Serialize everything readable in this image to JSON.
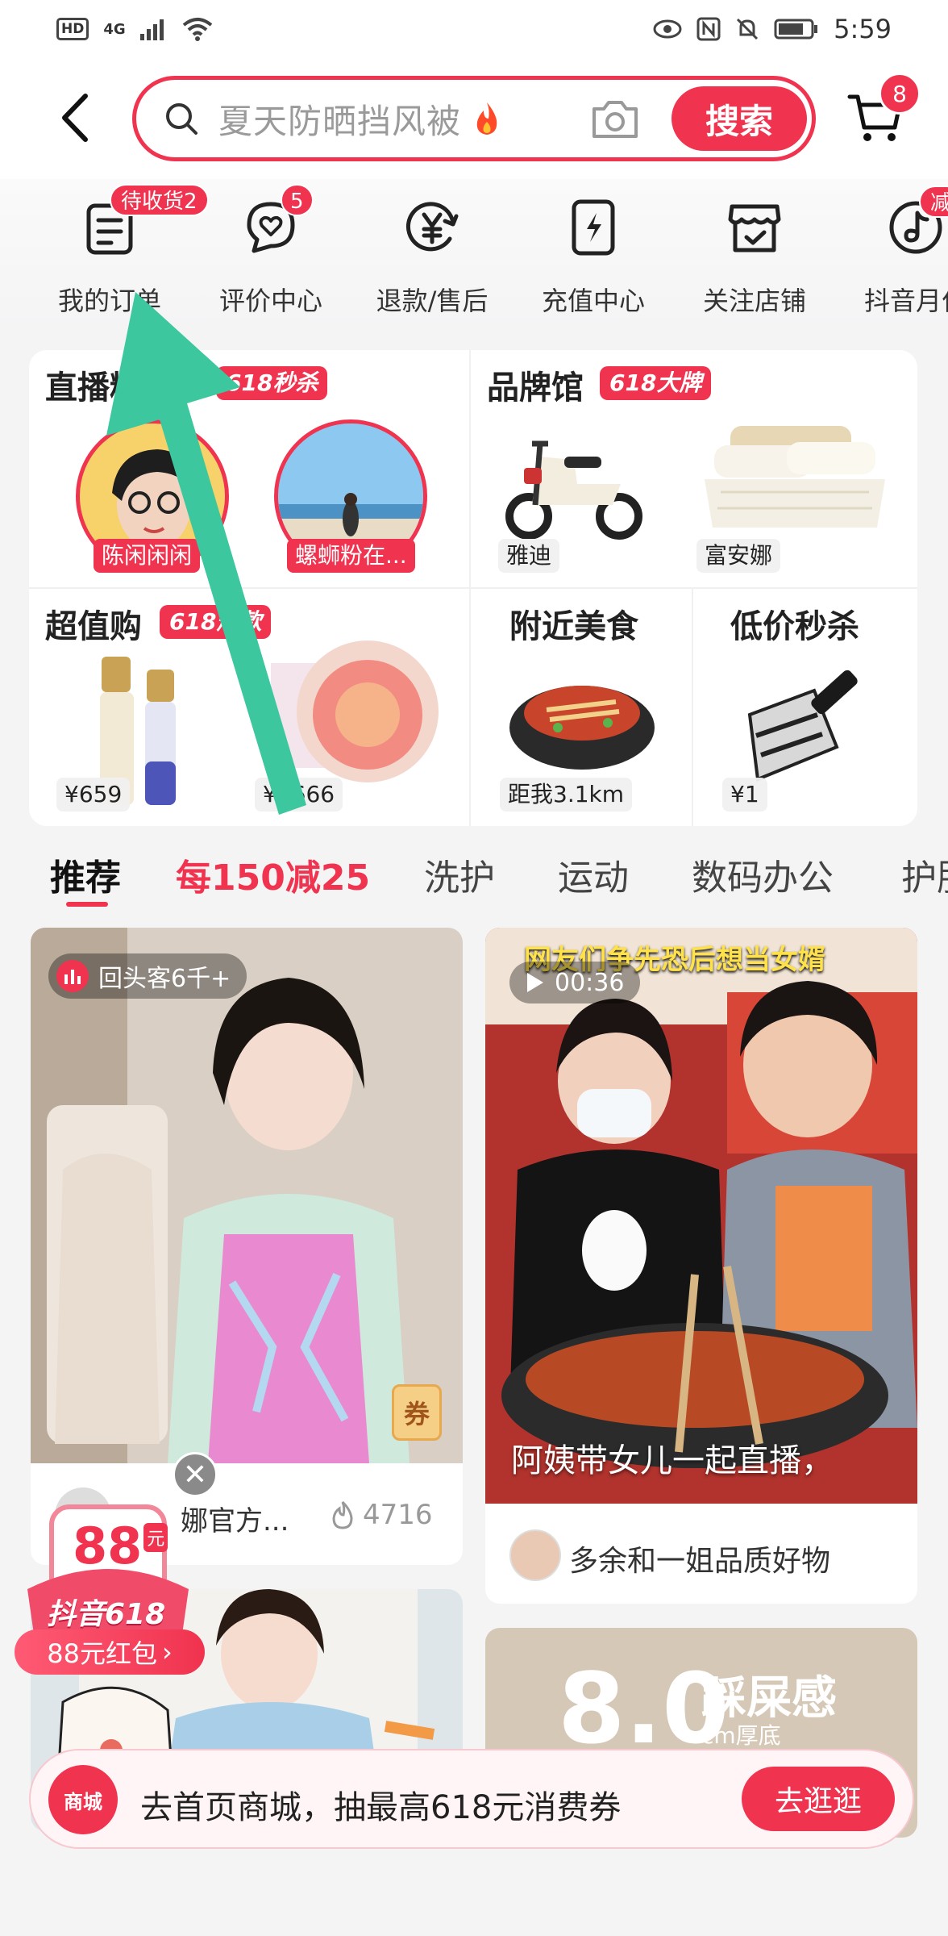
{
  "status_bar": {
    "hd": "HD",
    "network": "4G",
    "time": "5:59"
  },
  "header": {
    "search_placeholder": "夏天防晒挡风被",
    "search_button": "搜索",
    "cart_badge": "8"
  },
  "shortcuts": [
    {
      "label": "我的订单",
      "badge": "待收货2",
      "icon": "order-list-icon"
    },
    {
      "label": "评价中心",
      "badge": "5",
      "icon": "review-heart-icon"
    },
    {
      "label": "退款/售后",
      "icon": "refund-yen-icon"
    },
    {
      "label": "充值中心",
      "icon": "recharge-phone-icon"
    },
    {
      "label": "关注店铺",
      "icon": "store-icon"
    },
    {
      "label": "抖音月付",
      "badge": "减",
      "icon": "monthly-pay-icon",
      "sub": "月付"
    }
  ],
  "panel": {
    "live": {
      "title": "直播精选",
      "tag": "618秒杀",
      "streamers": [
        "陈闲闲闲",
        "螺蛳粉在..."
      ]
    },
    "brand": {
      "title": "品牌馆",
      "tag": "618大牌",
      "items": [
        "雅迪",
        "富安娜"
      ]
    },
    "value": {
      "title": "超值购",
      "tag": "618爆款",
      "prices": [
        "¥659",
        "¥2666"
      ]
    },
    "food": {
      "title": "附近美食",
      "distance": "距我3.1km"
    },
    "flash": {
      "title": "低价秒杀",
      "price": "¥1"
    }
  },
  "category_tabs": [
    "推荐",
    "每150减25",
    "洗护",
    "运动",
    "数码办公",
    "护肤"
  ],
  "feed": {
    "card1": {
      "pill": "回头客6千+",
      "coupon": "券",
      "shop": "娜官方...",
      "count": "4716"
    },
    "card2": {
      "overlay_top": "网友们争先恐后想当女婿",
      "duration": "00:36",
      "caption": "阿姨带女儿一起直播，",
      "shop": "多余和一姐品质好物"
    },
    "card4": {
      "big": "8.0",
      "side": "踩屎感",
      "sub": "cm厚底"
    }
  },
  "floating": {
    "amount": "88",
    "unit": "元",
    "brand": "抖音618",
    "button": "88元红包"
  },
  "banner": {
    "badge": "商城",
    "text": "去首页商城，抽最高618元消费券",
    "button": "去逛逛"
  },
  "colors": {
    "accent": "#f0334f",
    "arrow": "#3cc79f"
  }
}
